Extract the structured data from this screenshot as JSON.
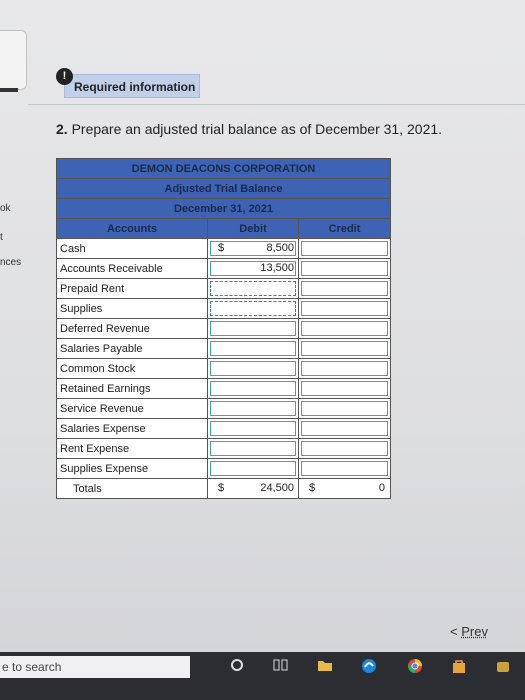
{
  "side": {
    "label1": "ok",
    "label2": "t",
    "label3": "nces"
  },
  "alert": {
    "glyph": "!"
  },
  "required_tab": "Required information",
  "question": {
    "number": "2.",
    "text": "Prepare an adjusted trial balance as of December 31, 2021."
  },
  "table": {
    "company": "DEMON DEACONS CORPORATION",
    "title": "Adjusted Trial Balance",
    "date": "December 31, 2021",
    "col_accounts": "Accounts",
    "col_debit": "Debit",
    "col_credit": "Credit",
    "rows": [
      {
        "account": "Cash",
        "dollar": "$",
        "debit": "8,500",
        "credit": ""
      },
      {
        "account": "Accounts Receivable",
        "debit": "13,500",
        "credit": ""
      },
      {
        "account": "Prepaid Rent",
        "debit": "",
        "credit": ""
      },
      {
        "account": "Supplies",
        "debit": "",
        "credit": ""
      },
      {
        "account": "Deferred Revenue",
        "debit": "",
        "credit": ""
      },
      {
        "account": "Salaries Payable",
        "debit": "",
        "credit": ""
      },
      {
        "account": "Common Stock",
        "debit": "",
        "credit": ""
      },
      {
        "account": "Retained Earnings",
        "debit": "",
        "credit": ""
      },
      {
        "account": "Service Revenue",
        "debit": "",
        "credit": ""
      },
      {
        "account": "Salaries Expense",
        "debit": "",
        "credit": ""
      },
      {
        "account": "Rent Expense",
        "debit": "",
        "credit": ""
      },
      {
        "account": "Supplies Expense",
        "debit": "",
        "credit": ""
      }
    ],
    "totals": {
      "label": "Totals",
      "debit_dollar": "$",
      "debit": "24,500",
      "credit_dollar": "$",
      "credit": "0"
    }
  },
  "nav": {
    "prev_glyph": "<",
    "prev": "Prev"
  },
  "taskbar": {
    "search_text": "e to search"
  },
  "colors": {
    "header_blue": "#3e63b4",
    "input_border": "#3fa9a0",
    "tab_blue": "#bfd0e8"
  }
}
